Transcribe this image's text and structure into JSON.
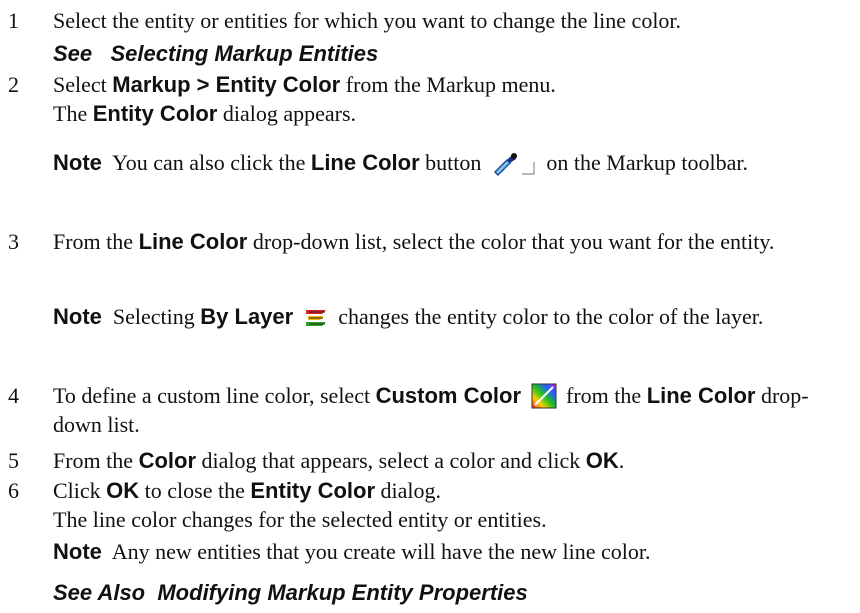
{
  "steps": [
    {
      "num": "1",
      "line1": "Select the entity or entities for which you want to change the line color.",
      "see_label": "See",
      "see_link": "Selecting Markup Entities"
    },
    {
      "num": "2",
      "t1": "Select ",
      "b1": "Markup > Entity Color",
      "t2": " from the Markup menu.",
      "t3": "The ",
      "b2": "Entity Color",
      "t4": " dialog appears."
    },
    {
      "num": "3",
      "t1": "From the ",
      "b1": "Line Color",
      "t2": " drop-down list, select the color that you want for the entity."
    },
    {
      "num": "4",
      "t1": "To define a custom line color, select ",
      "b1": "Custom Color",
      "t2": " from the ",
      "b2": "Line Color",
      "t3": " drop-down list."
    },
    {
      "num": "5",
      "t1": "From the ",
      "b1": "Color",
      "t2": " dialog that appears, select a color and click ",
      "b2": "OK",
      "t3": "."
    },
    {
      "num": "6",
      "t1": "Click ",
      "b1": "OK",
      "t2": " to close the ",
      "b2": "Entity Color",
      "t3": " dialog.",
      "line2": "The line color changes for the selected entity or entities."
    }
  ],
  "notes": [
    {
      "label": "Note",
      "t1": "You can also click the ",
      "b1": "Line Color",
      "t2": " button",
      "t3": " on the Markup toolbar.",
      "icon": "eyedropper-line-color-icon"
    },
    {
      "label": "Note",
      "t1": "Selecting ",
      "b1": "By Layer",
      "t2": " changes the entity color to the color of the layer.",
      "icon": "by-layer-icon"
    },
    {
      "label": "Note",
      "t1": "Any new entities that you create will have the new line color."
    }
  ],
  "custom_color_icon": "custom-color-icon",
  "see_also": {
    "label": "See Also",
    "link": "Modifying Markup Entity Properties"
  },
  "colors": {
    "text": "#111111"
  }
}
